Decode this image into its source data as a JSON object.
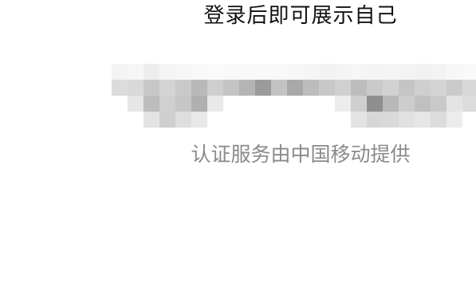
{
  "login": {
    "headline": "登录后即可展示自己",
    "masked_phone": "",
    "auth_provider_note": "认证服务由中国移动提供"
  },
  "colors": {
    "background": "#ffffff",
    "headline_text": "#111111",
    "note_text": "#8a8a8a"
  }
}
